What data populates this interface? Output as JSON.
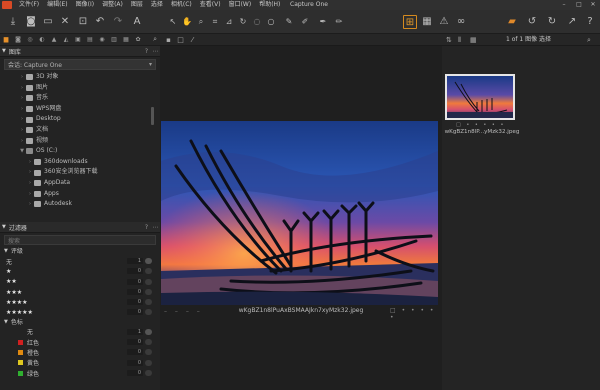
{
  "menubar": {
    "items": [
      "文件(F)",
      "编辑(E)",
      "图像(I)",
      "调整(A)",
      "图层",
      "选择",
      "相机(C)",
      "查看(V)",
      "窗口(W)",
      "帮助(H)"
    ],
    "title": "Capture One"
  },
  "library": {
    "title": "图库",
    "source": "会话: Capture One",
    "tree": [
      {
        "label": "3D 对象",
        "icon": "folder",
        "depth": 1
      },
      {
        "label": "图片",
        "icon": "folder",
        "depth": 1
      },
      {
        "label": "音乐",
        "icon": "music",
        "depth": 1
      },
      {
        "label": "WPS网盘",
        "icon": "cloud",
        "depth": 1
      },
      {
        "label": "Desktop",
        "icon": "folder",
        "depth": 1
      },
      {
        "label": "文档",
        "icon": "folder",
        "depth": 1
      },
      {
        "label": "视频",
        "icon": "folder",
        "depth": 1
      },
      {
        "label": "OS (C:)",
        "icon": "drive",
        "depth": 1,
        "expanded": true
      },
      {
        "label": "360downloads",
        "icon": "folder",
        "depth": 2
      },
      {
        "label": "360安全浏览器下载",
        "icon": "folder",
        "depth": 2
      },
      {
        "label": "AppData",
        "icon": "folder",
        "depth": 2
      },
      {
        "label": "Apps",
        "icon": "folder",
        "depth": 2
      },
      {
        "label": "Autodesk",
        "icon": "folder",
        "depth": 2
      }
    ]
  },
  "filters": {
    "title": "过滤器",
    "search_placeholder": "搜索",
    "rating_title": "评级",
    "ratings": [
      {
        "label": "无",
        "count": "1"
      },
      {
        "label": "★",
        "count": "0"
      },
      {
        "label": "★★",
        "count": "0"
      },
      {
        "label": "★★★",
        "count": "0"
      },
      {
        "label": "★★★★",
        "count": "0"
      },
      {
        "label": "★★★★★",
        "count": "0"
      }
    ],
    "color_title": "色标",
    "colors": [
      {
        "label": "无",
        "count": "1",
        "color": ""
      },
      {
        "label": "红色",
        "count": "0",
        "color": "#d02020"
      },
      {
        "label": "橙色",
        "count": "0",
        "color": "#e08a10"
      },
      {
        "label": "黄色",
        "count": "0",
        "color": "#e0c820"
      },
      {
        "label": "绿色",
        "count": "0",
        "color": "#30b030"
      }
    ]
  },
  "viewer": {
    "filename": "wKgBZ1n8lPuAxBSMAAJkn7xyMzk32.jpeg"
  },
  "browser": {
    "count": "1 of 1 图像 选择",
    "thumb_name": "wKgBZ1n8lP...yMzk32.jpeg"
  },
  "colors": {
    "accent": "#e6902a",
    "menubar": "#303030",
    "panel": "#232323"
  }
}
